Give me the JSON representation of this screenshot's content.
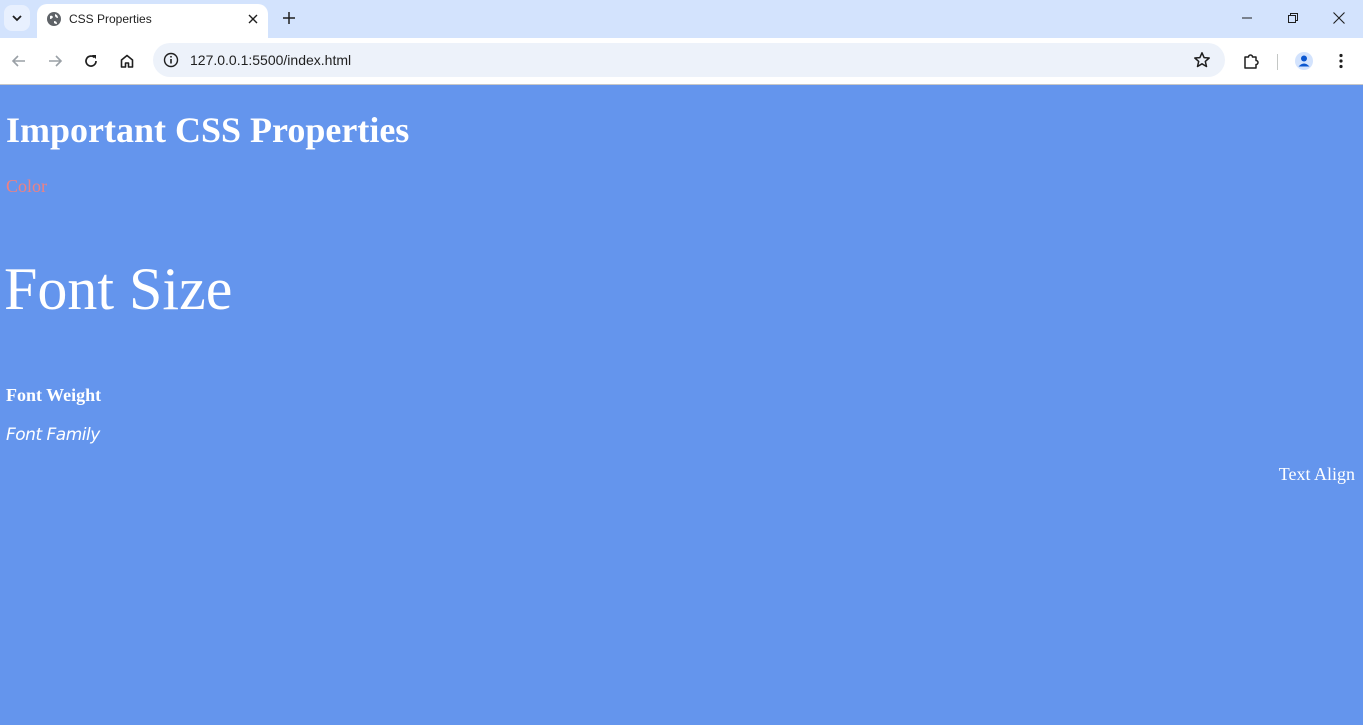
{
  "browser": {
    "tab": {
      "title": "CSS Properties"
    },
    "address_bar": {
      "url": "127.0.0.1:5500/index.html"
    },
    "icons": {
      "tab_search": "chevron-down-icon",
      "favicon": "globe-icon",
      "tab_close": "close-icon",
      "new_tab": "plus-icon",
      "back": "arrow-left-icon",
      "forward": "arrow-right-icon",
      "reload": "reload-icon",
      "home": "home-icon",
      "site_info": "info-icon",
      "bookmark": "star-icon",
      "extensions": "puzzle-icon",
      "profile": "person-icon",
      "menu": "kebab-menu-icon",
      "minimize": "minimize-icon",
      "restore": "restore-icon",
      "close_window": "close-icon"
    },
    "colors": {
      "tabstrip": "#d3e3fd",
      "toolbar": "#ffffff",
      "omnibox": "#edf2fa"
    }
  },
  "page": {
    "heading": "Important CSS Properties",
    "color_text": "Color",
    "font_size_text": "Font Size",
    "font_weight_text": "Font Weight",
    "font_family_text": "Font Family",
    "text_align_text": "Text Align",
    "colors": {
      "background": "#6495ed",
      "text": "#ffffff",
      "color_demo": "#f08080"
    }
  }
}
